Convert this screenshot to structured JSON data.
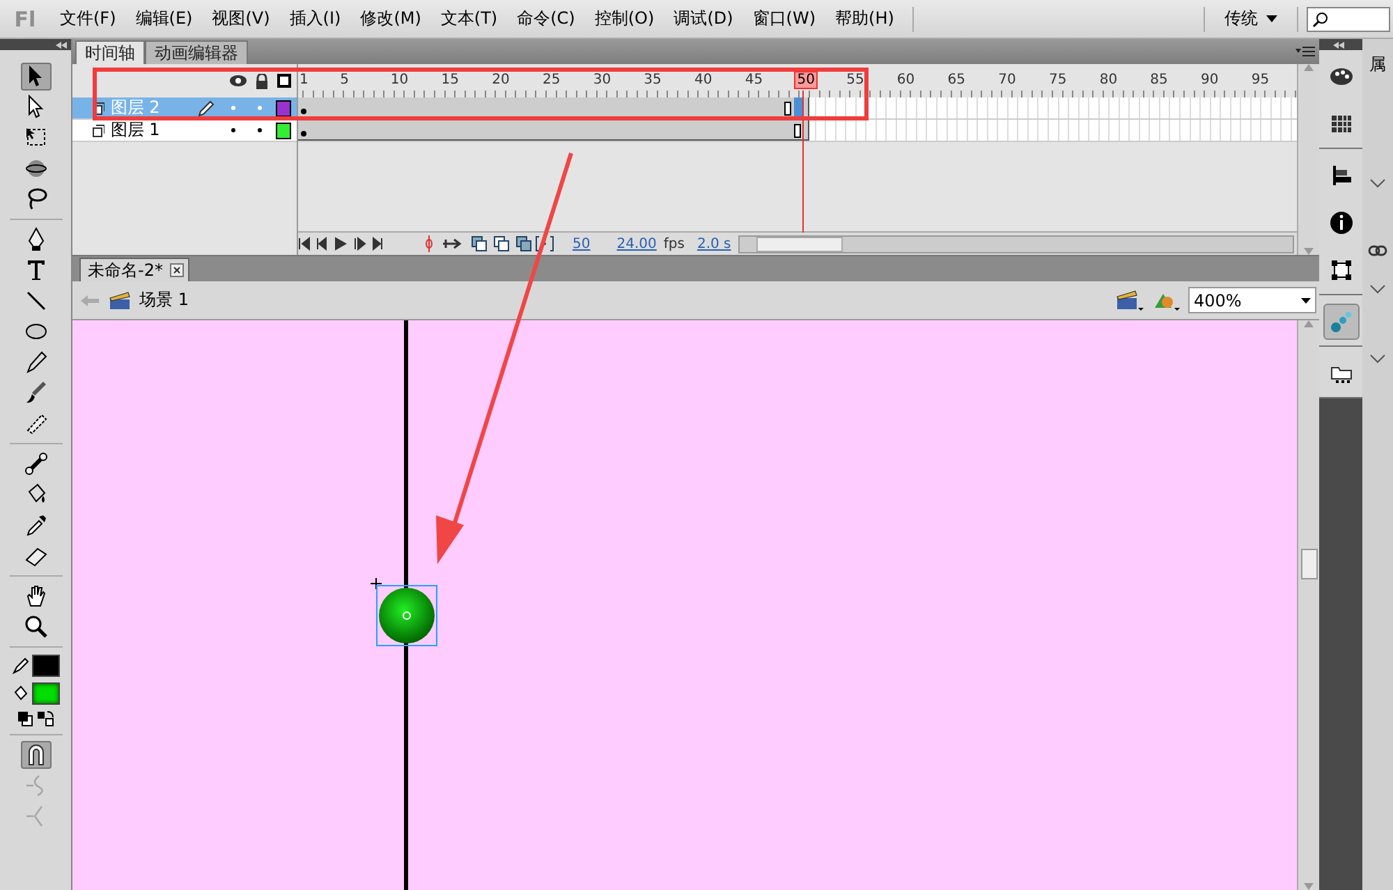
{
  "app": {
    "logo": "Fl",
    "menu": [
      "文件(F)",
      "编辑(E)",
      "视图(V)",
      "插入(I)",
      "修改(M)",
      "文本(T)",
      "命令(C)",
      "控制(O)",
      "调试(D)",
      "窗口(W)",
      "帮助(H)"
    ],
    "workspace": "传统"
  },
  "tools": [
    [
      {
        "kind": "select",
        "selected": true
      },
      {
        "kind": "subselect",
        "selected": false
      },
      {
        "kind": "transform",
        "selected": false
      },
      {
        "kind": "rotate3d",
        "selected": false
      },
      {
        "kind": "lasso",
        "selected": false
      }
    ],
    [
      {
        "kind": "pen",
        "selected": false
      },
      {
        "kind": "text",
        "selected": false
      },
      {
        "kind": "line",
        "selected": false
      },
      {
        "kind": "oval",
        "selected": false
      },
      {
        "kind": "pencil",
        "selected": false
      },
      {
        "kind": "brush",
        "selected": false
      },
      {
        "kind": "deco",
        "selected": false
      }
    ],
    [
      {
        "kind": "bone",
        "selected": false
      },
      {
        "kind": "bucket",
        "selected": false
      },
      {
        "kind": "eyedropper",
        "selected": false
      },
      {
        "kind": "eraser",
        "selected": false
      }
    ],
    [
      {
        "kind": "hand",
        "selected": false
      },
      {
        "kind": "zoom",
        "selected": false
      }
    ]
  ],
  "swatches": [
    {
      "kind": "stroke",
      "color": "#000000"
    },
    {
      "kind": "fill",
      "color": "#00dd00"
    }
  ],
  "options": [
    {
      "kind": "snap",
      "on": true,
      "disabled": false
    },
    {
      "kind": "smooth",
      "on": false,
      "disabled": true
    },
    {
      "kind": "straighten",
      "on": false,
      "disabled": true
    }
  ],
  "timeline": {
    "tabs": [
      {
        "label": "时间轴",
        "selected": true
      },
      {
        "label": "动画编辑器",
        "selected": false
      }
    ],
    "ruler": [
      {
        "label": "1",
        "current": false
      },
      {
        "label": "5",
        "current": false
      },
      {
        "label": "10",
        "current": false
      },
      {
        "label": "15",
        "current": false
      },
      {
        "label": "20",
        "current": false
      },
      {
        "label": "25",
        "current": false
      },
      {
        "label": "30",
        "current": false
      },
      {
        "label": "35",
        "current": false
      },
      {
        "label": "40",
        "current": false
      },
      {
        "label": "45",
        "current": false
      },
      {
        "label": "50",
        "current": true
      },
      {
        "label": "55",
        "current": false
      },
      {
        "label": "60",
        "current": false
      },
      {
        "label": "65",
        "current": false
      },
      {
        "label": "70",
        "current": false
      },
      {
        "label": "75",
        "current": false
      },
      {
        "label": "80",
        "current": false
      },
      {
        "label": "85",
        "current": false
      },
      {
        "label": "90",
        "current": false
      },
      {
        "label": "95",
        "current": false
      }
    ],
    "layers": [
      {
        "name": "图层 2",
        "selected": true,
        "editing": true,
        "color": "#9933cc"
      },
      {
        "name": "图层 1",
        "selected": false,
        "editing": false,
        "color": "#33ee33"
      }
    ],
    "status": {
      "frame": "50",
      "fps": "24.00",
      "fps_unit": "fps",
      "time": "2.0 s"
    }
  },
  "document": {
    "tab": "未命名-2*",
    "scene": "场景 1",
    "zoom": "400%"
  },
  "dock": [
    {
      "kind": "palette",
      "selected": false
    },
    {
      "kind": "swatches",
      "selected": false
    },
    {
      "kind": "align",
      "selected": false
    },
    {
      "kind": "info",
      "selected": false
    },
    {
      "kind": "transform",
      "selected": false
    },
    {
      "kind": "presets",
      "selected": true
    },
    {
      "kind": "library",
      "selected": false
    }
  ],
  "side_panel": {
    "title": "属"
  }
}
